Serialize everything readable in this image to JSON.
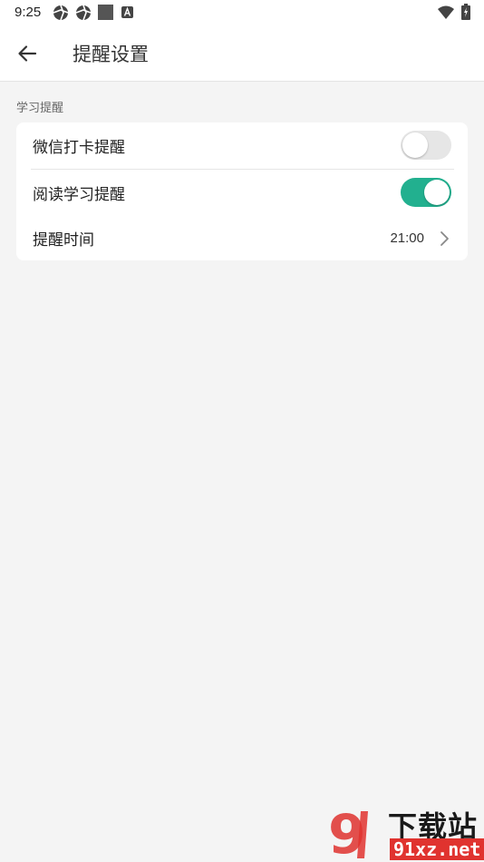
{
  "status_bar": {
    "time": "9:25",
    "left_icons": [
      "aperture-icon",
      "aperture-icon",
      "square-icon",
      "a-badge-icon"
    ],
    "right_icons": [
      "wifi-icon",
      "battery-charging-icon"
    ]
  },
  "app_bar": {
    "back_icon": "arrow-left-icon",
    "title": "提醒设置"
  },
  "section": {
    "label": "学习提醒",
    "rows": [
      {
        "label": "微信打卡提醒",
        "type": "toggle",
        "on": false
      },
      {
        "label": "阅读学习提醒",
        "type": "toggle",
        "on": true
      },
      {
        "label": "提醒时间",
        "type": "value",
        "value": "21:00",
        "icon": "chevron-right-icon"
      }
    ]
  },
  "watermark": {
    "logo": "9",
    "title": "下载站",
    "url": "91xz.net"
  },
  "colors": {
    "background": "#f4f4f4",
    "toggle_on": "#22b08f",
    "toggle_off": "#e6e6e6",
    "watermark_red": "#e0332f"
  }
}
